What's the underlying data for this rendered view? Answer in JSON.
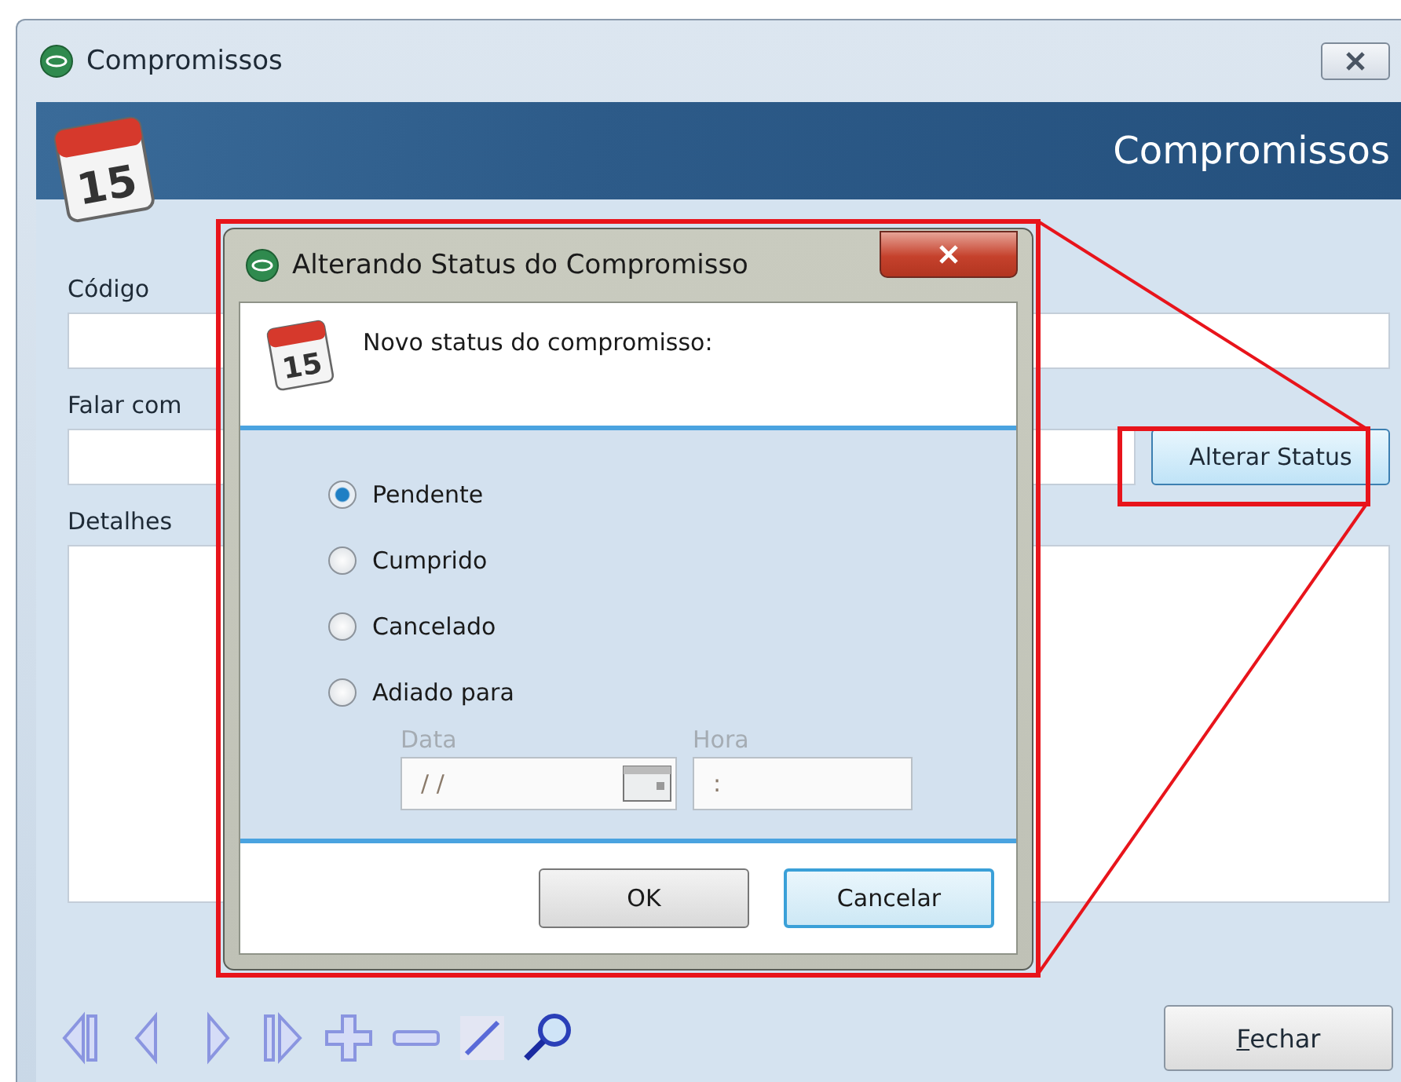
{
  "window": {
    "title": "Compromissos",
    "header_title": "Compromissos",
    "calendar_day": "15"
  },
  "form": {
    "fields": [
      {
        "label": "Código",
        "kind": "text"
      },
      {
        "label": "Falar com",
        "kind": "with_button",
        "button": "Alterar Status"
      },
      {
        "label": "Detalhes",
        "kind": "textarea"
      }
    ]
  },
  "footer": {
    "close_button": "Fechar"
  },
  "dialog": {
    "title": "Alterando Status do Compromisso",
    "prompt": "Novo status do compromisso:",
    "calendar_day": "15",
    "options": [
      {
        "label": "Pendente",
        "selected": true
      },
      {
        "label": "Cumprido",
        "selected": false
      },
      {
        "label": "Cancelado",
        "selected": false
      },
      {
        "label": "Adiado para",
        "selected": false
      }
    ],
    "date": {
      "label": "Data",
      "value": "/ /",
      "disabled": true
    },
    "time": {
      "label": "Hora",
      "value": ":",
      "disabled": true
    },
    "buttons": [
      {
        "label": "OK",
        "focused": false
      },
      {
        "label": "Cancelar",
        "focused": true
      }
    ]
  }
}
